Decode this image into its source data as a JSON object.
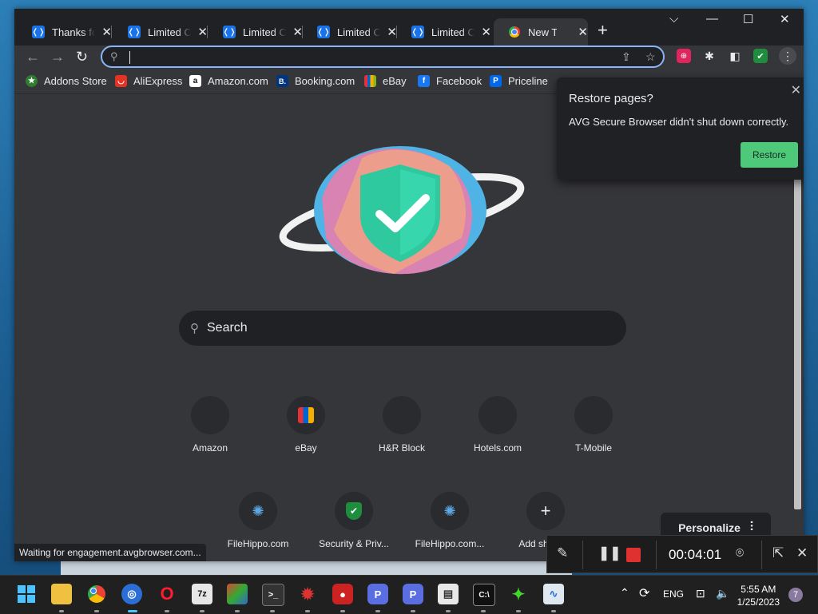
{
  "tabs": [
    {
      "title": "Thanks for"
    },
    {
      "title": "Limited Of"
    },
    {
      "title": "Limited Of"
    },
    {
      "title": "Limited Of"
    },
    {
      "title": "Limited Of"
    },
    {
      "title": "New Tab"
    }
  ],
  "bookmarks": [
    {
      "label": "Addons Store",
      "icon": "addons-store-icon",
      "color": "#2e7d32",
      "glyph": "★"
    },
    {
      "label": "AliExpress",
      "icon": "aliexpress-icon",
      "color": "#e43225",
      "glyph": "◡"
    },
    {
      "label": "Amazon.com",
      "icon": "amazon-icon",
      "color": "#ffffff",
      "glyph": "a"
    },
    {
      "label": "Booking.com",
      "icon": "booking-icon",
      "color": "#003580",
      "glyph": "B."
    },
    {
      "label": "eBay",
      "icon": "ebay-icon",
      "color": "#f5af02",
      "glyph": "▮"
    },
    {
      "label": "Facebook",
      "icon": "facebook-icon",
      "color": "#1877f2",
      "glyph": "f"
    },
    {
      "label": "Priceline",
      "icon": "priceline-icon",
      "color": "#0068ef",
      "glyph": "P"
    }
  ],
  "search": {
    "placeholder": "Search"
  },
  "shortcuts_row1": [
    {
      "label": "Amazon"
    },
    {
      "label": "eBay"
    },
    {
      "label": "H&R Block"
    },
    {
      "label": "Hotels.com"
    },
    {
      "label": "T-Mobile"
    }
  ],
  "shortcuts_row2": [
    {
      "label": "FileHippo.com"
    },
    {
      "label": "Security & Priv..."
    },
    {
      "label": "FileHippo.com..."
    },
    {
      "label": "Add shortcut"
    }
  ],
  "personalize": {
    "label": "Personalize"
  },
  "status_bar": {
    "text": "Waiting for engagement.avgbrowser.com..."
  },
  "restore_popup": {
    "title": "Restore pages?",
    "message": "AVG Secure Browser didn't shut down correctly.",
    "button": "Restore",
    "button_color": "#4ec97a"
  },
  "recorder": {
    "timer": "00:04:01"
  },
  "taskbar": {
    "language": "ENG",
    "time": "5:55 AM",
    "date": "1/25/2023",
    "notification_count": "7"
  }
}
